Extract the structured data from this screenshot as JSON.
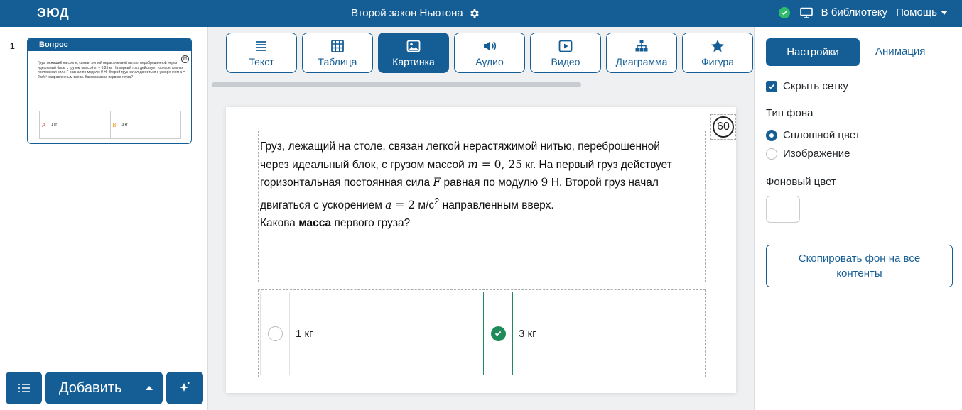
{
  "header": {
    "logo": "ЭЮД",
    "title": "Второй закон Ньютона",
    "library_label": "В библиотеку",
    "help_label": "Помощь"
  },
  "sidebar": {
    "slides": [
      {
        "number": "1",
        "type_label": "Вопрос",
        "timer": "60",
        "text": "Груз, лежащий на столе, связан легкой нерастяжимой нитью, переброшенной через идеальный блок, с грузом массой m = 0,25 кг. На первый груз действует горизонтальная постоянная сила F равная по модулю 9 Н. Второй груз начал двигаться с ускорением a = 2 м/с² направленным вверх. Какова масса первого груза?",
        "answers": [
          {
            "letter": "A",
            "text": "1 кг"
          },
          {
            "letter": "B",
            "text": "3 кг"
          }
        ]
      }
    ],
    "add_label": "Добавить"
  },
  "toolbar": {
    "items": [
      {
        "label": "Текст",
        "icon": "text-icon",
        "active": false
      },
      {
        "label": "Таблица",
        "icon": "table-icon",
        "active": false
      },
      {
        "label": "Картинка",
        "icon": "image-icon",
        "active": true
      },
      {
        "label": "Аудио",
        "icon": "audio-icon",
        "active": false
      },
      {
        "label": "Видео",
        "icon": "video-icon",
        "active": false
      },
      {
        "label": "Диаграмма",
        "icon": "diagram-icon",
        "active": false
      },
      {
        "label": "Фигура",
        "icon": "star-icon",
        "active": false
      }
    ]
  },
  "question": {
    "timer": "60",
    "line1": "Груз, лежащий на столе, связан легкой нерастяжимой нитью, переброшенной",
    "line2_a": "через идеальный блок, с грузом массой ",
    "line2_math_var": "m",
    "line2_math_val": " = 0, 25",
    "line2_b": " кг. На первый груз действует",
    "line3_a": "горизонтальная постоянная сила ",
    "line3_math_var": "F",
    "line3_b": " равная по модулю ",
    "line3_math_val": "9",
    "line3_c": " Н. Второй груз начал",
    "line4_a": "двигаться с ускорением ",
    "line4_math_var": "a",
    "line4_math_val": " = 2",
    "line4_unit": " м/с",
    "line4_sup": "2",
    "line4_b": " направленным вверх.",
    "line5_a": "Какова ",
    "line5_bold": "масса",
    "line5_b": " первого груза?",
    "answers": [
      {
        "text": "1 кг",
        "correct": false
      },
      {
        "text": "3 кг",
        "correct": true
      }
    ]
  },
  "settings": {
    "tab_settings": "Настройки",
    "tab_animation": "Анимация",
    "hide_grid_label": "Скрыть сетку",
    "hide_grid_checked": true,
    "bg_type_label": "Тип фона",
    "bg_options": [
      "Сплошной цвет",
      "Изображение"
    ],
    "bg_selected": "Сплошной цвет",
    "bg_color_label": "Фоновый цвет",
    "bg_color": "#ffffff",
    "copy_bg_label": "Скопировать фон на все контенты"
  },
  "colors": {
    "brand": "#155e95",
    "success": "#1f8a5a",
    "status_ok": "#2ebd6b"
  }
}
